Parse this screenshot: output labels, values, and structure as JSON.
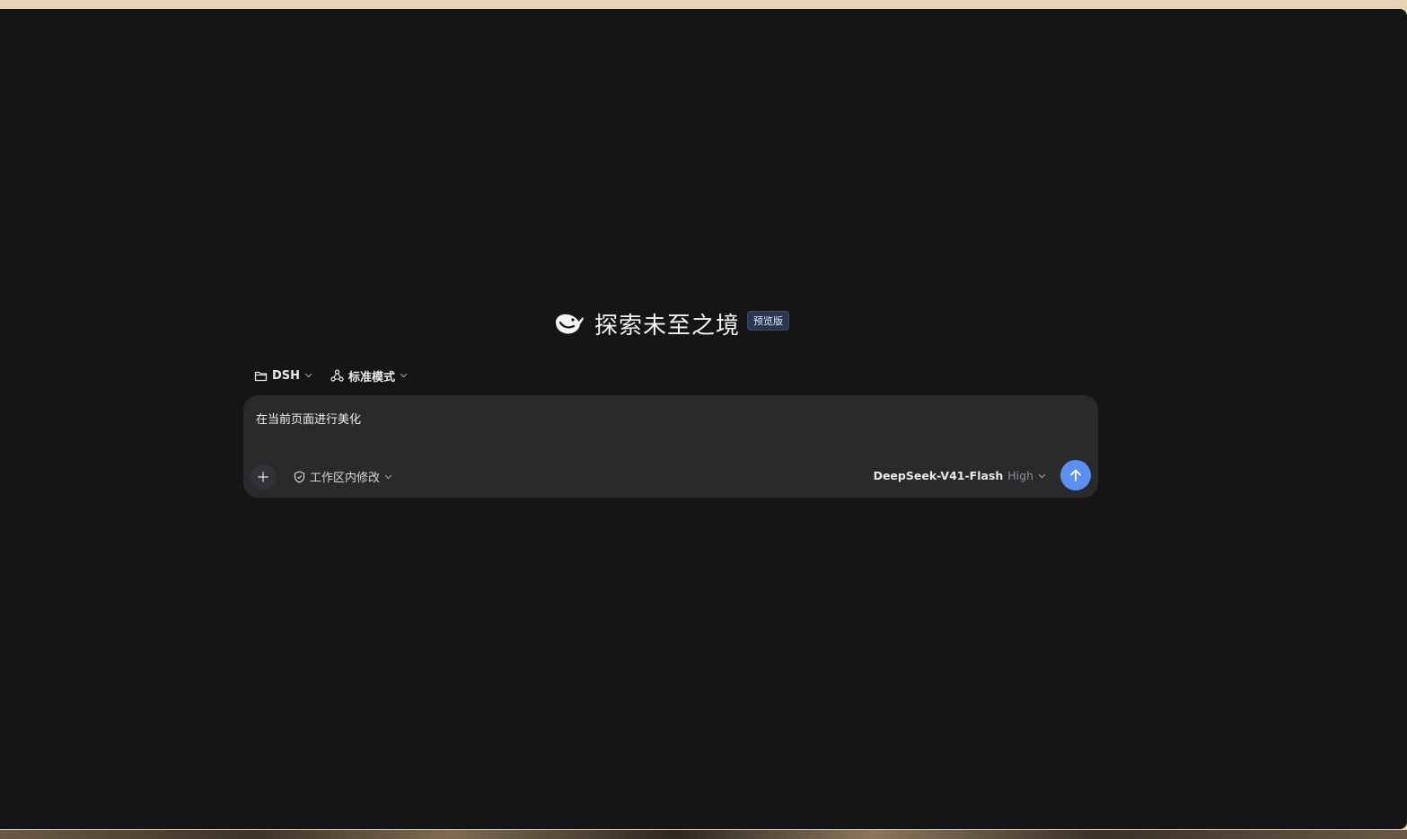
{
  "hero": {
    "title": "探索未至之境",
    "badge": "预览版",
    "logo_icon": "whale-logo-icon"
  },
  "toolbar": {
    "folder": {
      "label": "DSH",
      "icon": "folder-icon"
    },
    "mode": {
      "label": "标准模式",
      "icon": "mode-icon"
    }
  },
  "composer": {
    "prompt": "在当前页面进行美化",
    "scope_label": "工作区内修改",
    "scope_icon": "shield-icon",
    "add_icon": "plus-icon",
    "model_name": "DeepSeek-V41-Flash",
    "model_level": "High",
    "send_icon": "arrow-up-icon"
  },
  "colors": {
    "background": "#151517",
    "composer": "#2a2a2d",
    "send_button": "#5b8ff0",
    "badge_bg": "#2b3650"
  }
}
